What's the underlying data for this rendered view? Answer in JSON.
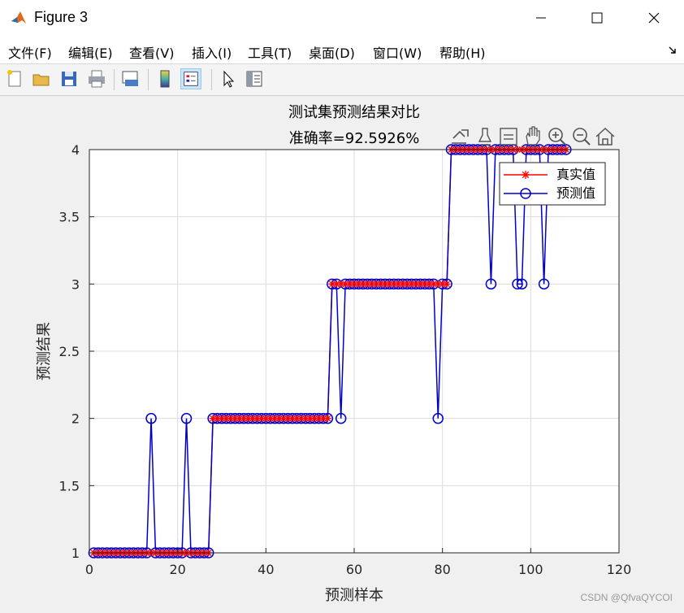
{
  "window": {
    "title": "Figure 3"
  },
  "menu": [
    "文件(F)",
    "编辑(E)",
    "查看(V)",
    "插入(I)",
    "工具(T)",
    "桌面(D)",
    "窗口(W)",
    "帮助(H)"
  ],
  "colors": {
    "true_series": "#ff0000",
    "pred_series": "#0000cc"
  },
  "toolbar_icons": [
    "new-file-icon",
    "open-folder-icon",
    "save-icon",
    "print-icon",
    "print-preview-icon",
    "colorbar-icon",
    "legend-icon",
    "pointer-icon",
    "property-inspector-icon"
  ],
  "axes_toolbar_icons": [
    "export-icon",
    "brush-icon",
    "data-tips-icon",
    "pan-icon",
    "zoom-in-icon",
    "zoom-out-icon",
    "home-icon"
  ],
  "watermark": "CSDN @QfvaQYCOI",
  "chart_data": {
    "type": "line",
    "title": "测试集预测结果对比",
    "subtitle": "准确率=92.5926%",
    "xlabel": "预测样本",
    "ylabel": "预测结果",
    "xlim": [
      0,
      120
    ],
    "ylim": [
      1,
      4
    ],
    "xticks": [
      0,
      20,
      40,
      60,
      80,
      100,
      120
    ],
    "yticks": [
      1,
      1.5,
      2,
      2.5,
      3,
      3.5,
      4
    ],
    "xtick_labels": [
      "0",
      "20",
      "40",
      "60",
      "80",
      "100",
      "120"
    ],
    "ytick_labels": [
      "1",
      "1.5",
      "2",
      "2.5",
      "3",
      "3.5",
      "4"
    ],
    "grid": true,
    "legend": {
      "placement": "top-right",
      "entries": [
        "真实值",
        "预测值"
      ]
    },
    "x": [
      1,
      2,
      3,
      4,
      5,
      6,
      7,
      8,
      9,
      10,
      11,
      12,
      13,
      14,
      15,
      16,
      17,
      18,
      19,
      20,
      21,
      22,
      23,
      24,
      25,
      26,
      27,
      28,
      29,
      30,
      31,
      32,
      33,
      34,
      35,
      36,
      37,
      38,
      39,
      40,
      41,
      42,
      43,
      44,
      45,
      46,
      47,
      48,
      49,
      50,
      51,
      52,
      53,
      54,
      55,
      56,
      57,
      58,
      59,
      60,
      61,
      62,
      63,
      64,
      65,
      66,
      67,
      68,
      69,
      70,
      71,
      72,
      73,
      74,
      75,
      76,
      77,
      78,
      79,
      80,
      81,
      82,
      83,
      84,
      85,
      86,
      87,
      88,
      89,
      90,
      91,
      92,
      93,
      94,
      95,
      96,
      97,
      98,
      99,
      100,
      101,
      102,
      103,
      104,
      105,
      106,
      107,
      108
    ],
    "series": [
      {
        "name": "真实值",
        "marker": "star",
        "values": [
          1,
          1,
          1,
          1,
          1,
          1,
          1,
          1,
          1,
          1,
          1,
          1,
          1,
          1,
          1,
          1,
          1,
          1,
          1,
          1,
          1,
          1,
          1,
          1,
          1,
          1,
          1,
          2,
          2,
          2,
          2,
          2,
          2,
          2,
          2,
          2,
          2,
          2,
          2,
          2,
          2,
          2,
          2,
          2,
          2,
          2,
          2,
          2,
          2,
          2,
          2,
          2,
          2,
          2,
          3,
          3,
          3,
          3,
          3,
          3,
          3,
          3,
          3,
          3,
          3,
          3,
          3,
          3,
          3,
          3,
          3,
          3,
          3,
          3,
          3,
          3,
          3,
          3,
          3,
          3,
          3,
          4,
          4,
          4,
          4,
          4,
          4,
          4,
          4,
          4,
          4,
          4,
          4,
          4,
          4,
          4,
          4,
          4,
          4,
          4,
          4,
          4,
          4,
          4,
          4,
          4,
          4,
          4
        ]
      },
      {
        "name": "预测值",
        "marker": "circle",
        "values": [
          1,
          1,
          1,
          1,
          1,
          1,
          1,
          1,
          1,
          1,
          1,
          1,
          1,
          2,
          1,
          1,
          1,
          1,
          1,
          1,
          1,
          2,
          1,
          1,
          1,
          1,
          1,
          2,
          2,
          2,
          2,
          2,
          2,
          2,
          2,
          2,
          2,
          2,
          2,
          2,
          2,
          2,
          2,
          2,
          2,
          2,
          2,
          2,
          2,
          2,
          2,
          2,
          2,
          2,
          3,
          3,
          2,
          3,
          3,
          3,
          3,
          3,
          3,
          3,
          3,
          3,
          3,
          3,
          3,
          3,
          3,
          3,
          3,
          3,
          3,
          3,
          3,
          3,
          2,
          3,
          3,
          4,
          4,
          4,
          4,
          4,
          4,
          4,
          4,
          4,
          3,
          4,
          4,
          4,
          4,
          4,
          3,
          3,
          4,
          4,
          4,
          4,
          3,
          4,
          4,
          4,
          4,
          4
        ]
      }
    ]
  }
}
